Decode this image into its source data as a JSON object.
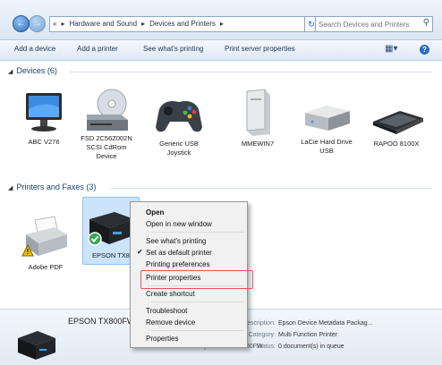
{
  "address": {
    "crumbs": [
      "«",
      "Hardware and Sound",
      "Devices and Printers"
    ],
    "search_placeholder": "Search Devices and Printers"
  },
  "toolbar": {
    "items": [
      "Add a device",
      "Add a printer",
      "See what's printing",
      "Print server properties"
    ]
  },
  "devices": {
    "title": "Devices (6)",
    "items": [
      {
        "label": "ABC V276",
        "icon": "monitor-icon"
      },
      {
        "label": "FSD 2C56Z002N SCSI CdRom Device",
        "icon": "cdrom-drive-icon"
      },
      {
        "label": "Generic USB Joystick",
        "icon": "gamepad-icon"
      },
      {
        "label": "MMEWIN7",
        "icon": "computer-tower-icon"
      },
      {
        "label": "LaCie Hard Drive USB",
        "icon": "external-drive-icon"
      },
      {
        "label": "RAPOO 8100X",
        "icon": "keyboard-icon"
      }
    ]
  },
  "printers": {
    "title": "Printers and Faxes (3)",
    "items": [
      {
        "label": "Adobe PDF",
        "icon": "printer-icon"
      },
      {
        "label": "EPSON TX8",
        "icon": "epson-printer-icon"
      }
    ]
  },
  "details": {
    "name": "EPSON TX800FW",
    "model_line": "Model: Stylus Photo TX800FW",
    "props": [
      {
        "key": "Description:",
        "value": "Epson Device Metadata Packag..."
      },
      {
        "key": "Category:",
        "value": "Multi Function Printer"
      },
      {
        "key": "Status:",
        "value": "0 document(s) in queue"
      }
    ]
  },
  "context_menu": {
    "items": [
      "Open",
      "Open in new window",
      "See what's printing",
      "Set as default printer",
      "Printing preferences",
      "Printer properties",
      "Create shortcut",
      "Troubleshoot",
      "Remove device",
      "Properties"
    ],
    "checked": "Set as default printer",
    "highlighted": "Printer properties"
  }
}
